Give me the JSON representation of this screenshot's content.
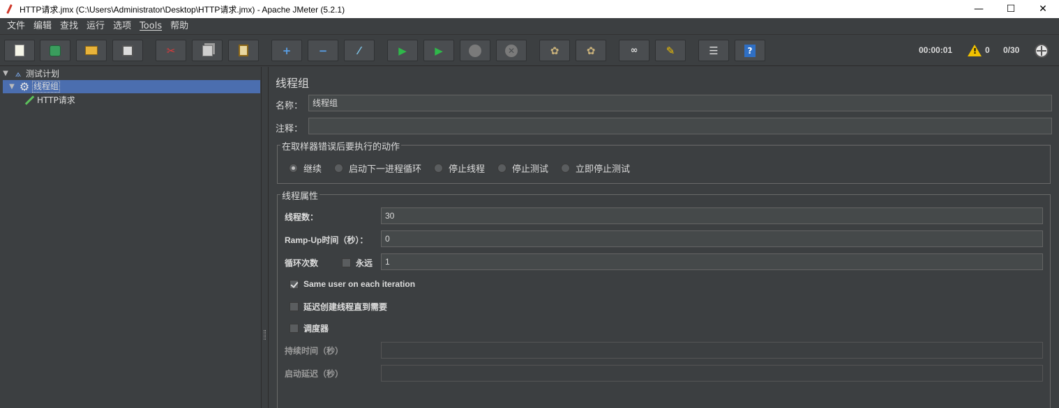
{
  "window": {
    "title": "HTTP请求.jmx (C:\\Users\\Administrator\\Desktop\\HTTP请求.jmx) - Apache JMeter (5.2.1)",
    "minimize": "—",
    "maximize": "☐",
    "close": "✕"
  },
  "menu": [
    "文件",
    "编辑",
    "查找",
    "运行",
    "选项",
    "Tools",
    "帮助"
  ],
  "toolbar": {
    "icons": [
      "new-icon",
      "templates-icon",
      "open-icon",
      "save-icon",
      "cut-icon",
      "copy-icon",
      "paste-icon",
      "expand-icon",
      "collapse-icon",
      "toggle-icon",
      "start-icon",
      "start-no-pause-icon",
      "stop-icon",
      "shutdown-icon",
      "clear-icon",
      "clear-all-icon",
      "search-icon",
      "reset-search-icon",
      "function-helper-icon",
      "help-icon"
    ],
    "elapsed": "00:00:01",
    "warnings": "0",
    "threads": "0/30"
  },
  "tree": {
    "root": "测试计划",
    "thread_group": "线程组",
    "sampler": "HTTP请求"
  },
  "panel": {
    "title": "线程组",
    "name_label": "名称：",
    "name_value": "线程组",
    "comment_label": "注释：",
    "comment_value": "",
    "error_action": {
      "title": "在取样器错误后要执行的动作",
      "options": [
        "继续",
        "启动下一进程循环",
        "停止线程",
        "停止测试",
        "立即停止测试"
      ],
      "selected": 0
    },
    "thread_props": {
      "title": "线程属性",
      "threads_label": "线程数：",
      "threads_value": "30",
      "rampup_label": "Ramp-Up时间（秒）：",
      "rampup_value": "0",
      "loop_label": "循环次数",
      "forever_label": "永远",
      "forever_checked": false,
      "loop_value": "1",
      "same_user_label": "Same user on each iteration",
      "same_user_checked": true,
      "delay_label": "延迟创建线程直到需要",
      "delay_checked": false,
      "scheduler_label": "调度器",
      "scheduler_checked": false,
      "duration_label": "持续时间（秒）",
      "duration_value": "",
      "startup_delay_label": "启动延迟（秒）",
      "startup_delay_value": ""
    }
  },
  "colors": {
    "background": "#3c3f41",
    "selection": "#4b6eaf",
    "field": "#45494a"
  }
}
